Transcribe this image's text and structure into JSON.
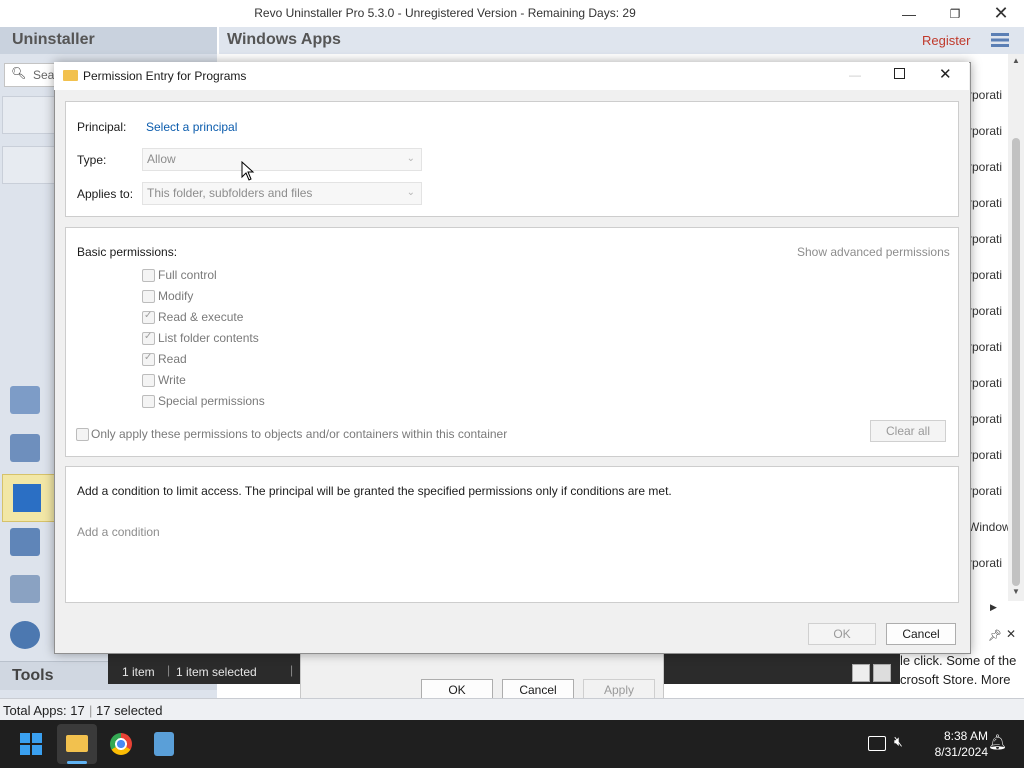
{
  "main_window": {
    "title": "Revo Uninstaller Pro 5.3.0 - Unregistered Version - Remaining Days: 29",
    "minimize_icon": "minimize-icon",
    "maximize_icon": "restore-icon",
    "close_icon": "close-icon"
  },
  "left_panel": {
    "header": "Uninstaller",
    "search_placeholder": "Sea",
    "tools_label": "Tools"
  },
  "right_panel": {
    "header": "Windows Apps",
    "register_label": "Register",
    "publisher_rows": [
      "rporati",
      "rporati",
      "rporati",
      "rporati",
      "rporati",
      "rporati",
      "rporati",
      "rporati",
      "rporati",
      "rporati",
      "rporati",
      "rporati",
      "Window",
      "rporati"
    ],
    "description_text": [
      "le click. Some of the",
      "crosoft Store. More"
    ]
  },
  "bottom_bar": {
    "item_count": "1 item",
    "item_selected": "1 item selected"
  },
  "status_bar": {
    "total_apps": "Total Apps: 17",
    "selected": "17 selected"
  },
  "back_dialog": {
    "ok_label": "OK",
    "cancel_label": "Cancel",
    "apply_label": "Apply"
  },
  "dialog": {
    "title": "Permission Entry for Programs",
    "principal_label": "Principal:",
    "principal_link": "Select a principal",
    "type_label": "Type:",
    "type_value": "Allow",
    "applies_label": "Applies to:",
    "applies_value": "This folder, subfolders and files",
    "basic_permissions_label": "Basic permissions:",
    "show_advanced_link": "Show advanced permissions",
    "permissions": [
      {
        "label": "Full control",
        "checked": false
      },
      {
        "label": "Modify",
        "checked": false
      },
      {
        "label": "Read & execute",
        "checked": true
      },
      {
        "label": "List folder contents",
        "checked": true
      },
      {
        "label": "Read",
        "checked": true
      },
      {
        "label": "Write",
        "checked": false
      },
      {
        "label": "Special permissions",
        "checked": false
      }
    ],
    "only_apply_label": "Only apply these permissions to objects and/or containers within this container",
    "clear_all_label": "Clear all",
    "condition_text": "Add a condition to limit access. The principal will be granted the specified permissions only if conditions are met.",
    "add_condition_label": "Add a condition",
    "ok_label": "OK",
    "cancel_label": "Cancel"
  },
  "taskbar": {
    "time": "8:38 AM",
    "date": "8/31/2024"
  }
}
